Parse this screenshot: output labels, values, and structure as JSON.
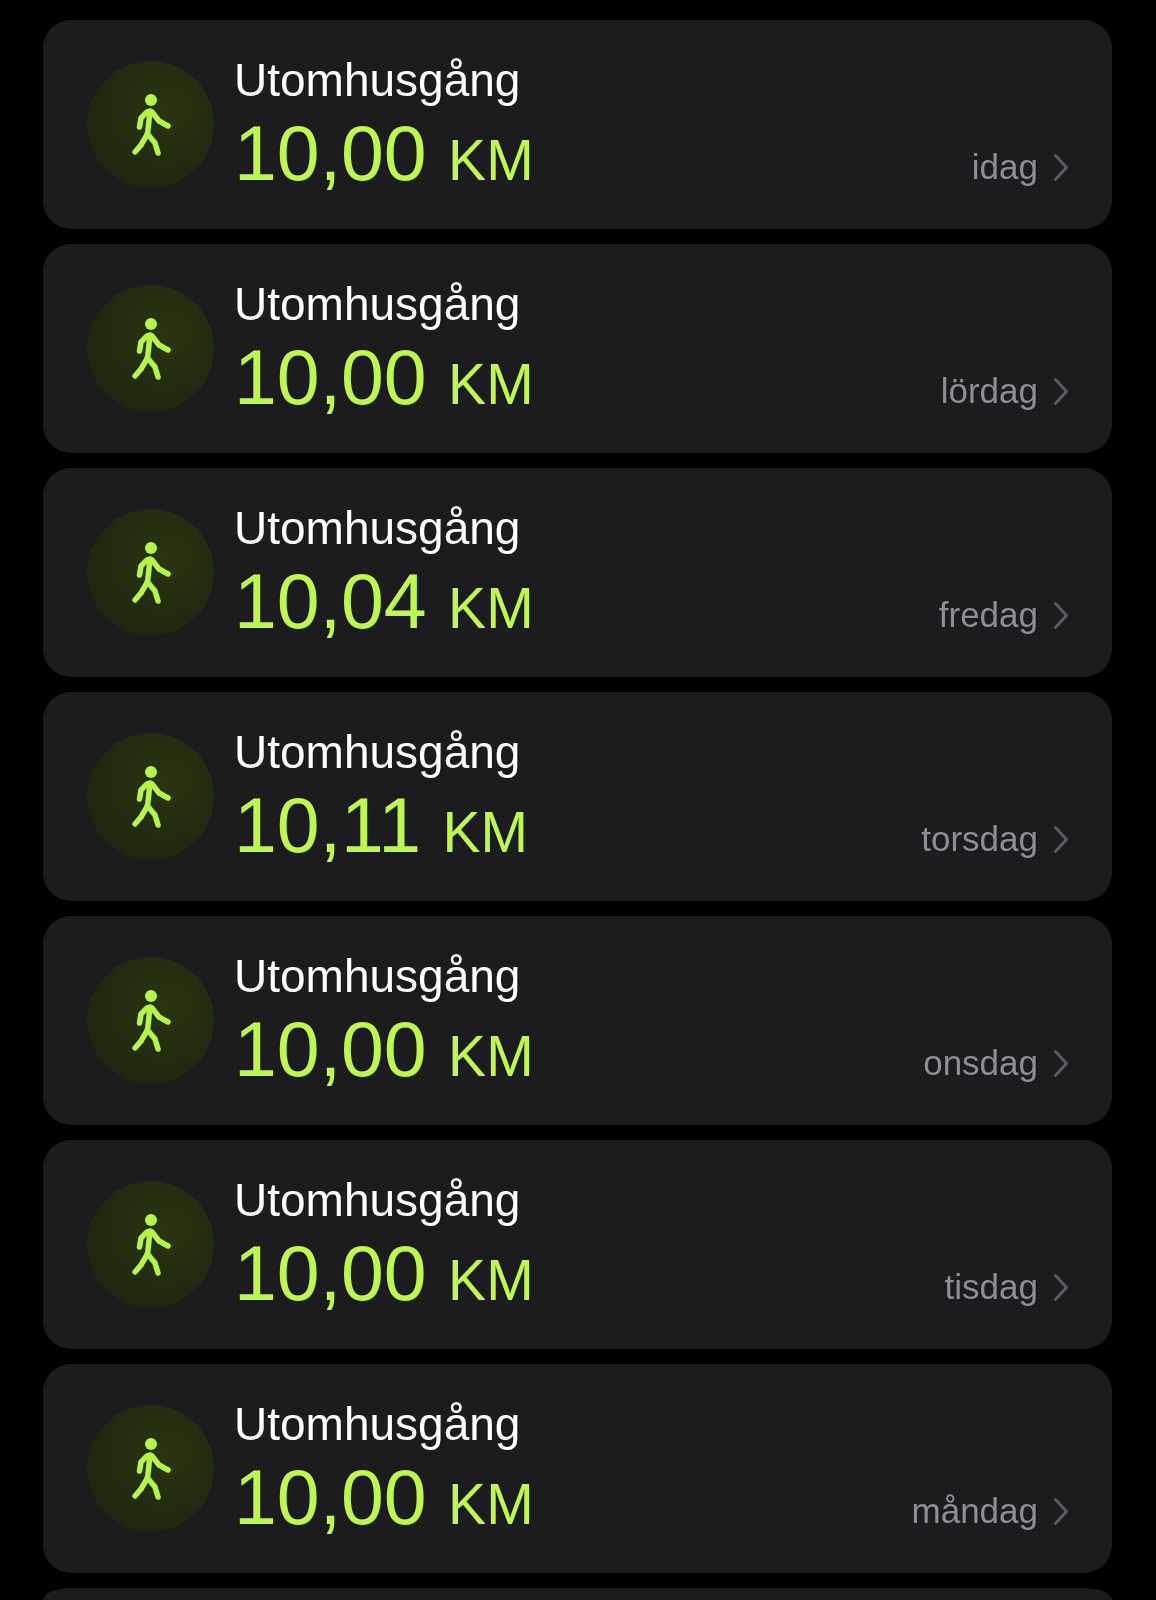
{
  "workouts": [
    {
      "title": "Utomhusgång",
      "distance": "10,00",
      "unit": "KM",
      "date": "idag"
    },
    {
      "title": "Utomhusgång",
      "distance": "10,00",
      "unit": "KM",
      "date": "lördag"
    },
    {
      "title": "Utomhusgång",
      "distance": "10,04",
      "unit": "KM",
      "date": "fredag"
    },
    {
      "title": "Utomhusgång",
      "distance": "10,11",
      "unit": "KM",
      "date": "torsdag"
    },
    {
      "title": "Utomhusgång",
      "distance": "10,00",
      "unit": "KM",
      "date": "onsdag"
    },
    {
      "title": "Utomhusgång",
      "distance": "10,00",
      "unit": "KM",
      "date": "tisdag"
    },
    {
      "title": "Utomhusgång",
      "distance": "10,00",
      "unit": "KM",
      "date": "måndag"
    }
  ],
  "more_below": true
}
